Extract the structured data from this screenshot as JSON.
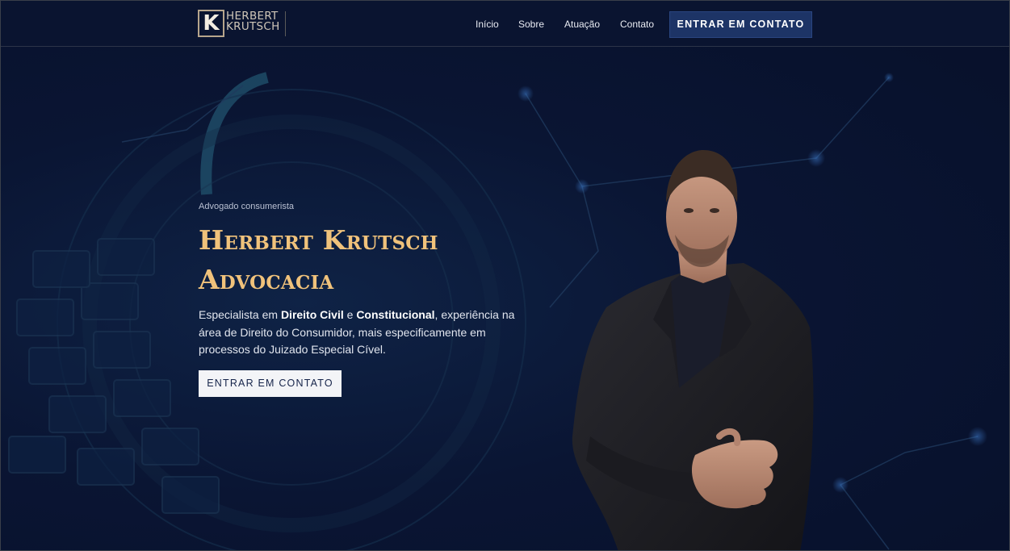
{
  "header": {
    "logo": {
      "mark": "K",
      "line1": "HERBERT",
      "line2": "KRUTSCH"
    },
    "nav": [
      {
        "label": "Início"
      },
      {
        "label": "Sobre"
      },
      {
        "label": "Atuação"
      },
      {
        "label": "Contato"
      }
    ],
    "cta_label": "ENTRAR EM CONTATO"
  },
  "hero": {
    "eyebrow": "Advogado consumerista",
    "title_line1": "Herbert Krutsch",
    "title_line2": "Advocacia",
    "desc": {
      "p1": "Especialista em ",
      "b1": "Direito Civil",
      "p2": " e ",
      "b2": "Constitucional",
      "p3": ", experiência na área de Direito do Consumidor, mais especificamente em processos do Juizado Especial Cível."
    },
    "cta_label": "ENTRAR EM CONTATO"
  },
  "colors": {
    "background": "#0b1430",
    "accent_gold": "#f0c27b",
    "button_navy": "#1d3466",
    "button_light": "#f3f4f7"
  },
  "icons": [
    "logo-k-icon",
    "circuit-background",
    "lawyer-portrait"
  ]
}
